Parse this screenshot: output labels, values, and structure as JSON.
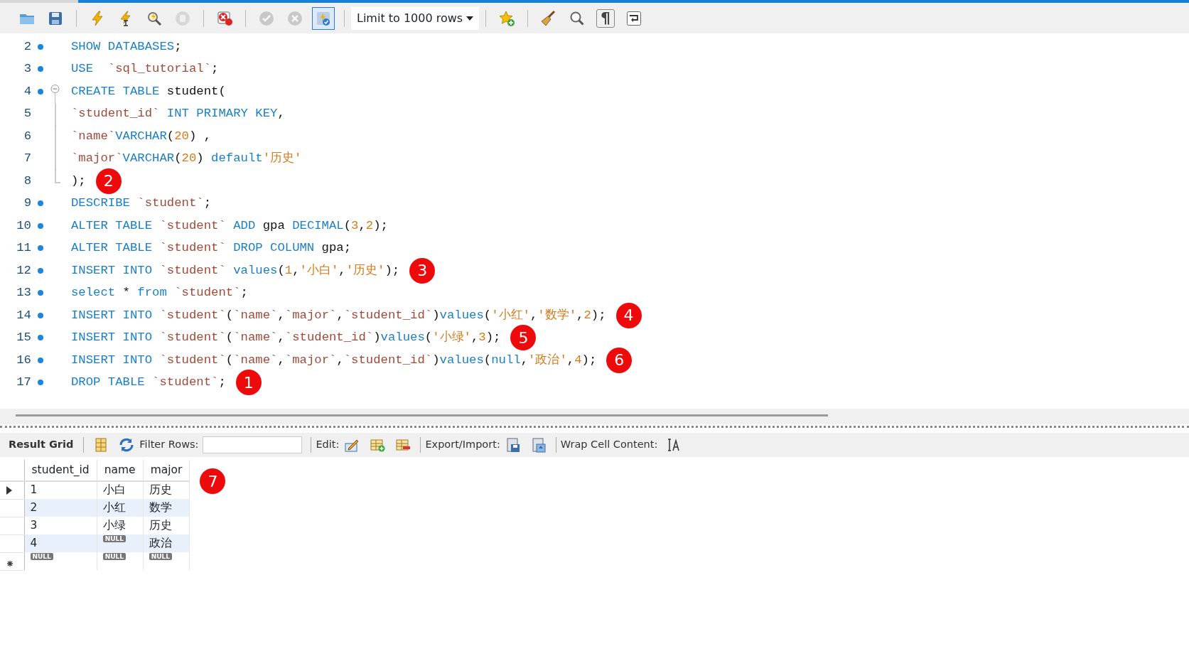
{
  "toolbar": {
    "groups": [
      [
        {
          "kind": "open",
          "disabled": false,
          "on": false
        },
        {
          "kind": "save",
          "disabled": false,
          "on": false
        }
      ],
      [
        {
          "kind": "execute",
          "disabled": false,
          "on": false
        },
        {
          "kind": "execute-current",
          "disabled": false,
          "on": false
        },
        {
          "kind": "explain",
          "disabled": false,
          "on": false
        },
        {
          "kind": "stop",
          "disabled": true,
          "on": false
        }
      ],
      [
        {
          "kind": "error-toggle",
          "disabled": false,
          "on": false
        }
      ],
      [
        {
          "kind": "commit",
          "disabled": true,
          "on": false
        },
        {
          "kind": "rollback",
          "disabled": true,
          "on": false
        },
        {
          "kind": "autocommit",
          "disabled": false,
          "on": true
        }
      ],
      [
        {
          "kind": "select",
          "value": "Limit to 1000 rows"
        }
      ],
      [
        {
          "kind": "bookmark",
          "disabled": false,
          "on": false
        }
      ],
      [
        {
          "kind": "beautify",
          "disabled": false,
          "on": false
        },
        {
          "kind": "find",
          "disabled": false,
          "on": false
        },
        {
          "kind": "invisibles",
          "label": "¶",
          "disabled": false,
          "on": false
        },
        {
          "kind": "wrap",
          "disabled": false,
          "on": false
        }
      ]
    ]
  },
  "editor": {
    "lines": [
      {
        "number": "2",
        "kind": "statement",
        "tokens": [
          {
            "kind": "kw",
            "text": "SHOW DATABASES"
          },
          {
            "kind": "plain",
            "text": ";"
          }
        ]
      },
      {
        "number": "3",
        "kind": "statement",
        "tokens": [
          {
            "kind": "kw",
            "text": "USE"
          },
          {
            "kind": "id",
            "text": "  `sql_tutorial`"
          },
          {
            "kind": "plain",
            "text": ";"
          }
        ]
      },
      {
        "number": "4",
        "kind": "statement-fold",
        "tokens": [
          {
            "kind": "kw",
            "text": "CREATE TABLE"
          },
          {
            "kind": "plain",
            "text": " student("
          }
        ]
      },
      {
        "number": "5",
        "kind": "fold-body",
        "tokens": [
          {
            "kind": "id",
            "text": "`student_id`"
          },
          {
            "kind": "kw",
            "text": " INT PRIMARY KEY"
          },
          {
            "kind": "plain",
            "text": ","
          }
        ]
      },
      {
        "number": "6",
        "kind": "fold-body",
        "tokens": [
          {
            "kind": "id",
            "text": "`name`"
          },
          {
            "kind": "kw",
            "text": "VARCHAR"
          },
          {
            "kind": "plain",
            "text": "("
          },
          {
            "kind": "num",
            "text": "20"
          },
          {
            "kind": "plain",
            "text": ") ,"
          }
        ]
      },
      {
        "number": "7",
        "kind": "fold-body",
        "tokens": [
          {
            "kind": "id",
            "text": "`major`"
          },
          {
            "kind": "kw",
            "text": "VARCHAR"
          },
          {
            "kind": "plain",
            "text": "("
          },
          {
            "kind": "num",
            "text": "20"
          },
          {
            "kind": "plain",
            "text": ")"
          },
          {
            "kind": "kw",
            "text": " default"
          },
          {
            "kind": "str",
            "text": "'历史'"
          }
        ]
      },
      {
        "number": "8",
        "kind": "fold-end",
        "tokens": [
          {
            "kind": "plain",
            "text": ");"
          }
        ],
        "callout": "2"
      },
      {
        "number": "9",
        "kind": "statement",
        "tokens": [
          {
            "kind": "kw",
            "text": "DESCRIBE"
          },
          {
            "kind": "id",
            "text": " `student`"
          },
          {
            "kind": "plain",
            "text": ";"
          }
        ]
      },
      {
        "number": "10",
        "kind": "statement",
        "tokens": [
          {
            "kind": "kw",
            "text": "ALTER TABLE"
          },
          {
            "kind": "id",
            "text": " `student`"
          },
          {
            "kind": "kw",
            "text": " ADD"
          },
          {
            "kind": "plain",
            "text": " gpa"
          },
          {
            "kind": "kw",
            "text": " DECIMAL"
          },
          {
            "kind": "plain",
            "text": "("
          },
          {
            "kind": "num",
            "text": "3"
          },
          {
            "kind": "plain",
            "text": ","
          },
          {
            "kind": "num",
            "text": "2"
          },
          {
            "kind": "plain",
            "text": ");"
          }
        ]
      },
      {
        "number": "11",
        "kind": "statement",
        "tokens": [
          {
            "kind": "kw",
            "text": "ALTER TABLE"
          },
          {
            "kind": "id",
            "text": " `student`"
          },
          {
            "kind": "kw",
            "text": " DROP COLUMN"
          },
          {
            "kind": "plain",
            "text": " gpa;"
          }
        ]
      },
      {
        "number": "12",
        "kind": "statement",
        "tokens": [
          {
            "kind": "kw",
            "text": "INSERT INTO"
          },
          {
            "kind": "id",
            "text": " `student`"
          },
          {
            "kind": "kw",
            "text": " values"
          },
          {
            "kind": "plain",
            "text": "("
          },
          {
            "kind": "num",
            "text": "1"
          },
          {
            "kind": "plain",
            "text": ","
          },
          {
            "kind": "str",
            "text": "'小白'"
          },
          {
            "kind": "plain",
            "text": ","
          },
          {
            "kind": "str",
            "text": "'历史'"
          },
          {
            "kind": "plain",
            "text": ");"
          }
        ],
        "callout": "3"
      },
      {
        "number": "13",
        "kind": "statement",
        "tokens": [
          {
            "kind": "kw",
            "text": "select"
          },
          {
            "kind": "plain",
            "text": " * "
          },
          {
            "kind": "kw",
            "text": "from"
          },
          {
            "kind": "id",
            "text": " `student`"
          },
          {
            "kind": "plain",
            "text": ";"
          }
        ]
      },
      {
        "number": "14",
        "kind": "statement",
        "tokens": [
          {
            "kind": "kw",
            "text": "INSERT INTO"
          },
          {
            "kind": "id",
            "text": " `student`"
          },
          {
            "kind": "plain",
            "text": "("
          },
          {
            "kind": "id",
            "text": "`name`"
          },
          {
            "kind": "plain",
            "text": ","
          },
          {
            "kind": "id",
            "text": "`major`"
          },
          {
            "kind": "plain",
            "text": ","
          },
          {
            "kind": "id",
            "text": "`student_id`"
          },
          {
            "kind": "plain",
            "text": ")"
          },
          {
            "kind": "kw",
            "text": "values"
          },
          {
            "kind": "plain",
            "text": "("
          },
          {
            "kind": "str",
            "text": "'小红'"
          },
          {
            "kind": "plain",
            "text": ","
          },
          {
            "kind": "str",
            "text": "'数学'"
          },
          {
            "kind": "plain",
            "text": ","
          },
          {
            "kind": "num",
            "text": "2"
          },
          {
            "kind": "plain",
            "text": ");"
          }
        ],
        "callout": "4"
      },
      {
        "number": "15",
        "kind": "statement",
        "tokens": [
          {
            "kind": "kw",
            "text": "INSERT INTO"
          },
          {
            "kind": "id",
            "text": " `student`"
          },
          {
            "kind": "plain",
            "text": "("
          },
          {
            "kind": "id",
            "text": "`name`"
          },
          {
            "kind": "plain",
            "text": ","
          },
          {
            "kind": "id",
            "text": "`student_id`"
          },
          {
            "kind": "plain",
            "text": ")"
          },
          {
            "kind": "kw",
            "text": "values"
          },
          {
            "kind": "plain",
            "text": "("
          },
          {
            "kind": "str",
            "text": "'小绿'"
          },
          {
            "kind": "plain",
            "text": ","
          },
          {
            "kind": "num",
            "text": "3"
          },
          {
            "kind": "plain",
            "text": ");"
          }
        ],
        "callout": "5"
      },
      {
        "number": "16",
        "kind": "statement",
        "tokens": [
          {
            "kind": "kw",
            "text": "INSERT INTO"
          },
          {
            "kind": "id",
            "text": " `student`"
          },
          {
            "kind": "plain",
            "text": "("
          },
          {
            "kind": "id",
            "text": "`name`"
          },
          {
            "kind": "plain",
            "text": ","
          },
          {
            "kind": "id",
            "text": "`major`"
          },
          {
            "kind": "plain",
            "text": ","
          },
          {
            "kind": "id",
            "text": "`student_id`"
          },
          {
            "kind": "plain",
            "text": ")"
          },
          {
            "kind": "kw",
            "text": "values"
          },
          {
            "kind": "plain",
            "text": "("
          },
          {
            "kind": "kw",
            "text": "null"
          },
          {
            "kind": "plain",
            "text": ","
          },
          {
            "kind": "str",
            "text": "'政治'"
          },
          {
            "kind": "plain",
            "text": ","
          },
          {
            "kind": "num",
            "text": "4"
          },
          {
            "kind": "plain",
            "text": ");"
          }
        ],
        "callout": "6"
      },
      {
        "number": "17",
        "kind": "statement",
        "tokens": [
          {
            "kind": "kw",
            "text": "DROP TABLE"
          },
          {
            "kind": "id",
            "text": " `student`"
          },
          {
            "kind": "plain",
            "text": ";"
          }
        ],
        "callout": "1"
      }
    ]
  },
  "result_toolbar": {
    "tab": "Result Grid",
    "filter_label": "Filter Rows:",
    "edit_label": "Edit:",
    "export_label": "Export/Import:",
    "wrap_label": "Wrap Cell Content:"
  },
  "result_grid": {
    "columns": [
      "student_id",
      "name",
      "major"
    ],
    "callout": "7",
    "rows": [
      {
        "kind": "data",
        "selected": true,
        "cells": [
          {
            "kind": "text",
            "text": "1"
          },
          {
            "kind": "text",
            "text": "小白"
          },
          {
            "kind": "text",
            "text": "历史"
          }
        ]
      },
      {
        "kind": "data",
        "selected": false,
        "cells": [
          {
            "kind": "text",
            "text": "2"
          },
          {
            "kind": "text",
            "text": "小红"
          },
          {
            "kind": "text",
            "text": "数学"
          }
        ]
      },
      {
        "kind": "data",
        "selected": false,
        "cells": [
          {
            "kind": "text",
            "text": "3"
          },
          {
            "kind": "text",
            "text": "小绿"
          },
          {
            "kind": "text",
            "text": "历史"
          }
        ]
      },
      {
        "kind": "data",
        "selected": false,
        "cells": [
          {
            "kind": "text",
            "text": "4"
          },
          {
            "kind": "null",
            "text": "NULL"
          },
          {
            "kind": "text",
            "text": "政治"
          }
        ]
      },
      {
        "kind": "new",
        "selected": false,
        "cells": [
          {
            "kind": "null",
            "text": "NULL"
          },
          {
            "kind": "null",
            "text": "NULL"
          },
          {
            "kind": "null",
            "text": "NULL"
          }
        ]
      }
    ]
  }
}
